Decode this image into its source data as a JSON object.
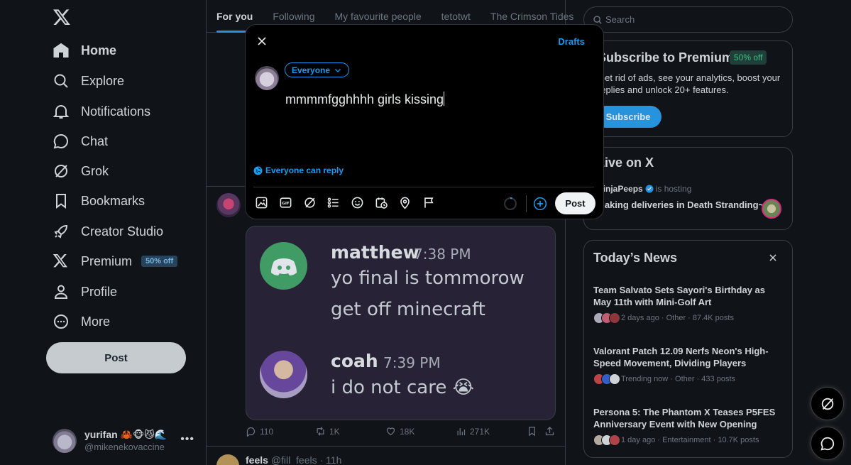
{
  "nav": {
    "items": [
      {
        "label": "Home",
        "icon": "home-icon"
      },
      {
        "label": "Explore",
        "icon": "search-icon"
      },
      {
        "label": "Notifications",
        "icon": "bell-icon"
      },
      {
        "label": "Chat",
        "icon": "chat-icon"
      },
      {
        "label": "Grok",
        "icon": "grok-icon"
      },
      {
        "label": "Bookmarks",
        "icon": "bookmark-icon"
      },
      {
        "label": "Creator Studio",
        "icon": "rocket-icon"
      },
      {
        "label": "Premium",
        "icon": "x-logo-icon",
        "badge": "50% off"
      },
      {
        "label": "Profile",
        "icon": "person-icon"
      },
      {
        "label": "More",
        "icon": "more-circle-icon"
      }
    ],
    "post_label": "Post"
  },
  "account": {
    "name": "yurifan 🦀🐵😼🌊",
    "handle": "@mikenekovaccine"
  },
  "tabs": [
    "For you",
    "Following",
    "My favourite people",
    "tetotwt",
    "The Crimson Tides"
  ],
  "composer": {
    "drafts_label": "Drafts",
    "audience": "Everyone",
    "text": "mmmmfgghhhh girls kissing",
    "reply_setting": "Everyone can reply",
    "post_label": "Post"
  },
  "feed_post": {
    "image": {
      "msg1": {
        "name": "matthew",
        "time": "7:38 PM",
        "line1": "yo final is tommorow",
        "line2": "get off minecraft"
      },
      "msg2": {
        "name": "coah",
        "time": "7:39 PM",
        "line1": "i do not care 😭"
      }
    },
    "stats": {
      "replies": "110",
      "reposts": "1K",
      "likes": "18K",
      "views": "271K"
    }
  },
  "next_post": {
    "name": "feels",
    "handle": "@fill_feels",
    "time": "· 11h"
  },
  "search": {
    "placeholder": "Search"
  },
  "premium_card": {
    "title": "Subscribe to Premium",
    "badge": "50% off",
    "description": "Get rid of ads, see your analytics, boost your replies and unlock 20+ features.",
    "button": "Subscribe"
  },
  "live": {
    "title": "Live on X",
    "host": "NinjaPeeps",
    "status": "is hosting",
    "topic": "Making deliveries in Death Stranding~!"
  },
  "news": {
    "title": "Today’s News",
    "items": [
      {
        "headline": "Team Salvato Sets Sayori's Birthday as May 11th with Mini-Golf Art",
        "meta": "2 days ago · Other · 87.4K posts"
      },
      {
        "headline": "Valorant Patch 12.09 Nerfs Neon's High-Speed Movement, Dividing Players",
        "meta": "Trending now · Other · 433 posts"
      },
      {
        "headline": "Persona 5: The Phantom X Teases P5FES Anniversary Event with New Opening",
        "meta": "1 day ago · Entertainment · 10.7K posts"
      }
    ]
  },
  "colors": {
    "accent": "#1d9bf0",
    "background": "#000000",
    "border": "#2f3336",
    "muted": "#71767b"
  }
}
